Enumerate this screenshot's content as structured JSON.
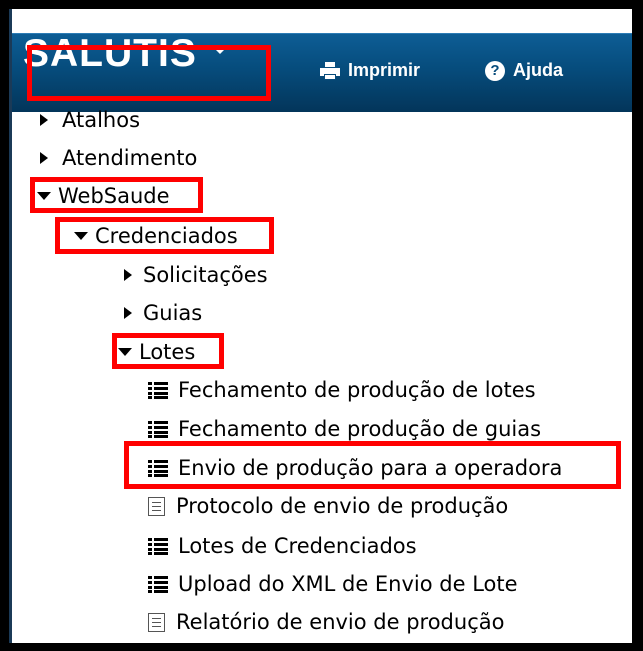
{
  "header": {
    "brand": "SALUTIS",
    "print_label": "Imprimir",
    "help_label": "Ajuda",
    "colors": {
      "bar_top": "#0d5d95",
      "bar_bottom": "#03355a",
      "highlight": "#ff0000"
    }
  },
  "tree": {
    "atalhos": "Atalhos",
    "atendimento": "Atendimento",
    "websaude": "WebSaude",
    "credenciados": "Credenciados",
    "solicitacoes": "Solicitações",
    "guias": "Guias",
    "lotes": "Lotes",
    "lotes_children": [
      {
        "label": "Fechamento de produção de lotes",
        "icon": "list-icon"
      },
      {
        "label": "Fechamento de produção de guias",
        "icon": "list-icon"
      },
      {
        "label": "Envio de produção para a operadora",
        "icon": "list-icon"
      },
      {
        "label": "Protocolo de envio de produção",
        "icon": "document-icon"
      },
      {
        "label": "Lotes de Credenciados",
        "icon": "list-icon"
      },
      {
        "label": "Upload do XML de Envio de Lote",
        "icon": "list-icon"
      },
      {
        "label": "Relatório de envio de produção",
        "icon": "document-icon"
      }
    ]
  }
}
